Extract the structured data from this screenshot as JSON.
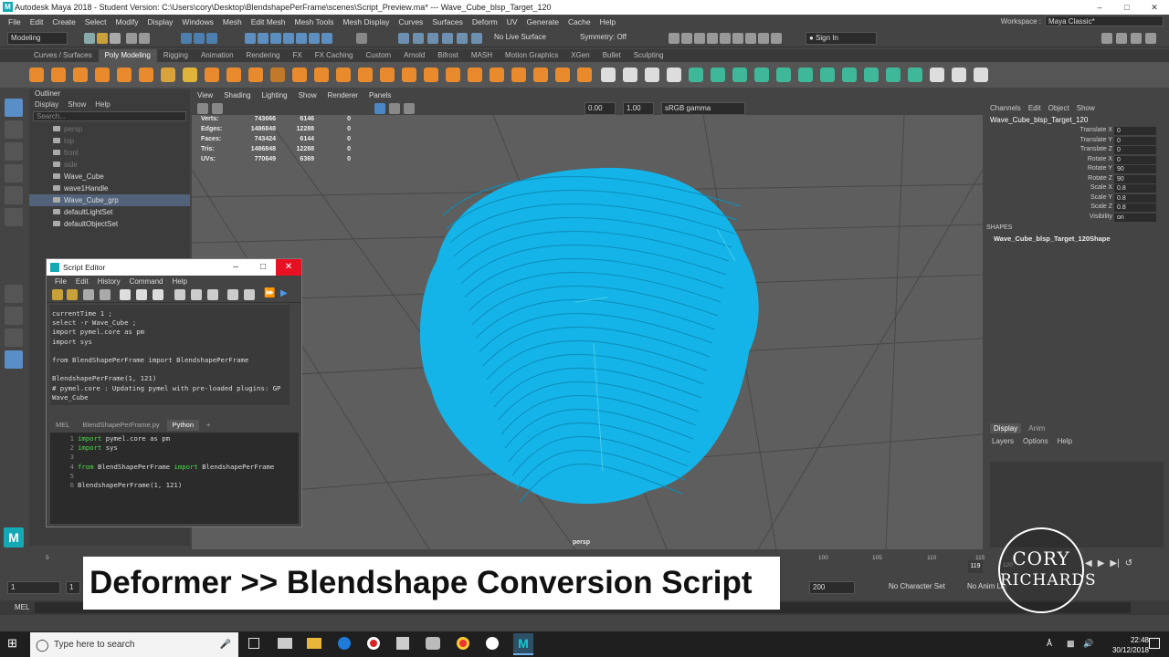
{
  "window": {
    "title": "Autodesk Maya 2018 - Student Version: C:\\Users\\cory\\Desktop\\BlendshapePerFrame\\scenes\\Script_Preview.ma*  ---  Wave_Cube_blsp_Target_120"
  },
  "menubar": [
    "File",
    "Edit",
    "Create",
    "Select",
    "Modify",
    "Display",
    "Windows",
    "Mesh",
    "Edit Mesh",
    "Mesh Tools",
    "Mesh Display",
    "Curves",
    "Surfaces",
    "Deform",
    "UV",
    "Generate",
    "Cache",
    "Help"
  ],
  "workspace": {
    "label": "Workspace :",
    "value": "Maya Classic*"
  },
  "statusline": {
    "mode": "Modeling",
    "live_surface": "No Live Surface",
    "symmetry": "Symmetry: Off",
    "signin": "Sign In"
  },
  "shelf_tabs": [
    "Curves / Surfaces",
    "Poly Modeling",
    "Rigging",
    "Animation",
    "Rendering",
    "FX",
    "FX Caching",
    "Custom",
    "Arnold",
    "Bifrost",
    "MASH",
    "Motion Graphics",
    "XGen",
    "Bullet",
    "Sculpting"
  ],
  "shelf_active": "Poly Modeling",
  "outliner": {
    "title": "Outliner",
    "menu": [
      "Display",
      "Show",
      "Help"
    ],
    "search_placeholder": "Search...",
    "items": [
      {
        "label": "persp",
        "dim": true
      },
      {
        "label": "top",
        "dim": true
      },
      {
        "label": "front",
        "dim": true
      },
      {
        "label": "side",
        "dim": true
      },
      {
        "label": "Wave_Cube",
        "dim": false
      },
      {
        "label": "wave1Handle",
        "dim": false
      },
      {
        "label": "Wave_Cube_grp",
        "dim": false
      },
      {
        "label": "defaultLightSet",
        "dim": false
      },
      {
        "label": "defaultObjectSet",
        "dim": false
      }
    ]
  },
  "viewport": {
    "menu": [
      "View",
      "Shading",
      "Lighting",
      "Show",
      "Renderer",
      "Panels"
    ],
    "exposure": "0.00",
    "gamma": "1.00",
    "colorspace": "sRGB gamma",
    "camera": "persp",
    "hud": [
      {
        "label": "Verts:",
        "a": "743666",
        "b": "6146",
        "c": "0"
      },
      {
        "label": "Edges:",
        "a": "1486848",
        "b": "12288",
        "c": "0"
      },
      {
        "label": "Faces:",
        "a": "743424",
        "b": "6144",
        "c": "0"
      },
      {
        "label": "Tris:",
        "a": "1486848",
        "b": "12288",
        "c": "0"
      },
      {
        "label": "UVs:",
        "a": "770649",
        "b": "6369",
        "c": "0"
      }
    ],
    "mesh_color": "#15b4e8"
  },
  "channelbox": {
    "menu": [
      "Channels",
      "Edit",
      "Object",
      "Show"
    ],
    "object": "Wave_Cube_blsp_Target_120",
    "attrs": [
      {
        "name": "Translate X",
        "value": "0"
      },
      {
        "name": "Translate Y",
        "value": "0"
      },
      {
        "name": "Translate Z",
        "value": "0"
      },
      {
        "name": "Rotate X",
        "value": "0"
      },
      {
        "name": "Rotate Y",
        "value": "90"
      },
      {
        "name": "Rotate Z",
        "value": "90"
      },
      {
        "name": "Scale X",
        "value": "0.8"
      },
      {
        "name": "Scale Y",
        "value": "0.8"
      },
      {
        "name": "Scale Z",
        "value": "0.8"
      },
      {
        "name": "Visibility",
        "value": "on"
      }
    ],
    "shapes_label": "SHAPES",
    "shape": "Wave_Cube_blsp_Target_120Shape"
  },
  "layers": {
    "tabs": [
      "Display",
      "Anim"
    ],
    "menu": [
      "Layers",
      "Options",
      "Help"
    ]
  },
  "script_editor": {
    "title": "Script Editor",
    "menu": [
      "File",
      "Edit",
      "History",
      "Command",
      "Help"
    ],
    "history": [
      "currentTime 1 ;",
      "select -r Wave_Cube ;",
      "import pymel.core as pm",
      "import sys",
      "",
      "from BlendShapePerFrame import BlendshapePerFrame",
      "",
      "BlendshapePerFrame(1, 121)",
      "# pymel.core : Updating pymel with pre-loaded plugins: GP",
      "Wave_Cube"
    ],
    "tabs": [
      "MEL",
      "BlendShapePerFrame.py",
      "Python",
      "+"
    ],
    "active_tab": "Python",
    "code": [
      {
        "n": "1",
        "kw": "import",
        "rest": " pymel.core as pm"
      },
      {
        "n": "2",
        "kw": "import",
        "rest": " sys"
      },
      {
        "n": "3",
        "kw": "",
        "rest": ""
      },
      {
        "n": "4",
        "kw": "from",
        "rest": " BlendShapePerFrame ",
        "kw2": "import",
        "rest2": " BlendshapePerFrame"
      },
      {
        "n": "5",
        "kw": "",
        "rest": ""
      },
      {
        "n": "6",
        "kw": "",
        "rest": "BlendshapePerFrame(1, 121)"
      }
    ]
  },
  "timeslider": {
    "ticks": [
      "5",
      "100",
      "105",
      "110",
      "115"
    ],
    "current": "119",
    "end_tick": "120"
  },
  "range": {
    "start": "1",
    "start2": "1",
    "end": "200",
    "character_set": "No Character Set",
    "anim_layer": "No Anim Layer"
  },
  "cmdline": {
    "label": "MEL"
  },
  "caption": "Deformer >> Blendshape Conversion Script",
  "logo": {
    "line1": "CORY",
    "line2": "RICHARDS"
  },
  "taskbar": {
    "search_placeholder": "Type here to search",
    "time": "22:48",
    "date": "30/12/2018"
  }
}
